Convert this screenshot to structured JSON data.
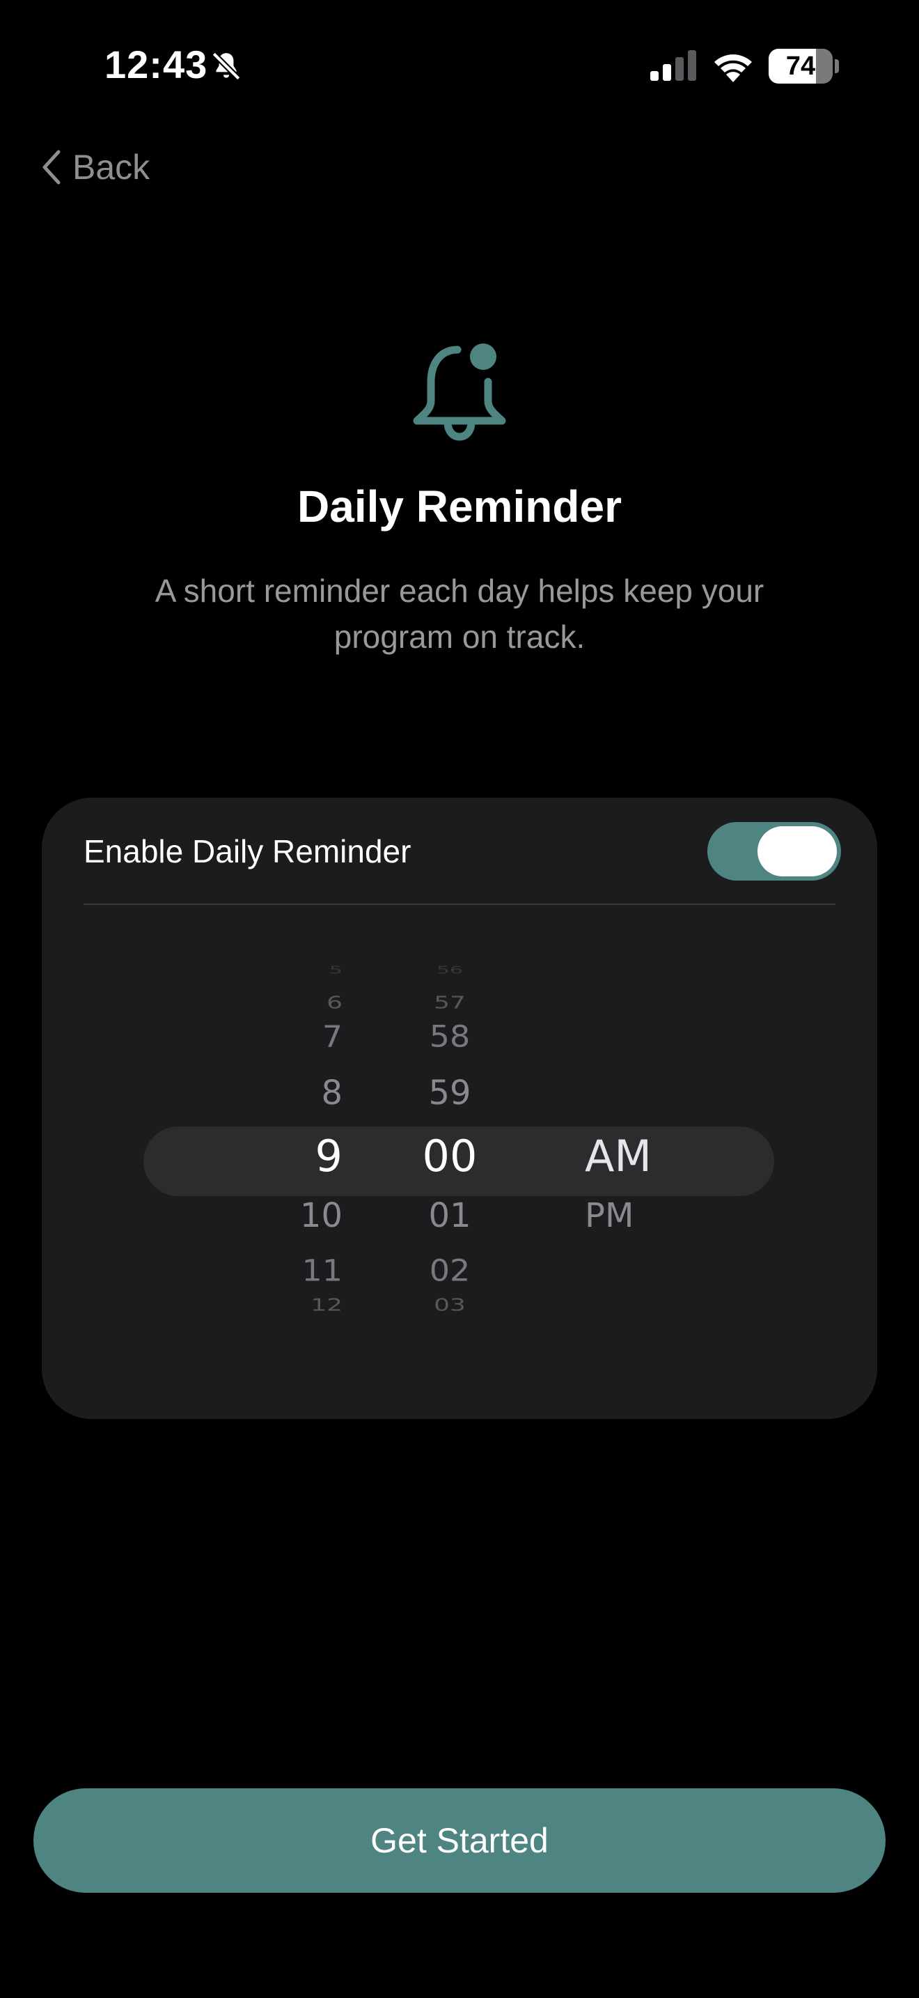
{
  "status_bar": {
    "time": "12:43",
    "battery": "74",
    "icons": [
      "bell-slash-icon",
      "cellular-signal-icon",
      "wifi-icon",
      "battery-icon"
    ]
  },
  "nav": {
    "back_label": "Back",
    "back_icon": "chevron-left-icon"
  },
  "header": {
    "icon": "bell-badge-icon",
    "title": "Daily Reminder",
    "subtitle": "A short reminder each day helps keep your program on track."
  },
  "reminder_card": {
    "toggle_label": "Enable Daily Reminder",
    "toggle_on": true,
    "picker": {
      "hours": [
        "5",
        "6",
        "7",
        "8",
        "9",
        "10",
        "11",
        "12"
      ],
      "minutes": [
        "56",
        "57",
        "58",
        "59",
        "00",
        "01",
        "02",
        "03"
      ],
      "periods": [
        "AM",
        "PM"
      ],
      "selected": {
        "hour": "9",
        "minute": "00",
        "period": "AM"
      }
    }
  },
  "cta": {
    "label": "Get Started"
  },
  "colors": {
    "accent": "#4e8583",
    "background": "#000000",
    "card": "#1c1c1e",
    "muted_text": "#98989d"
  }
}
